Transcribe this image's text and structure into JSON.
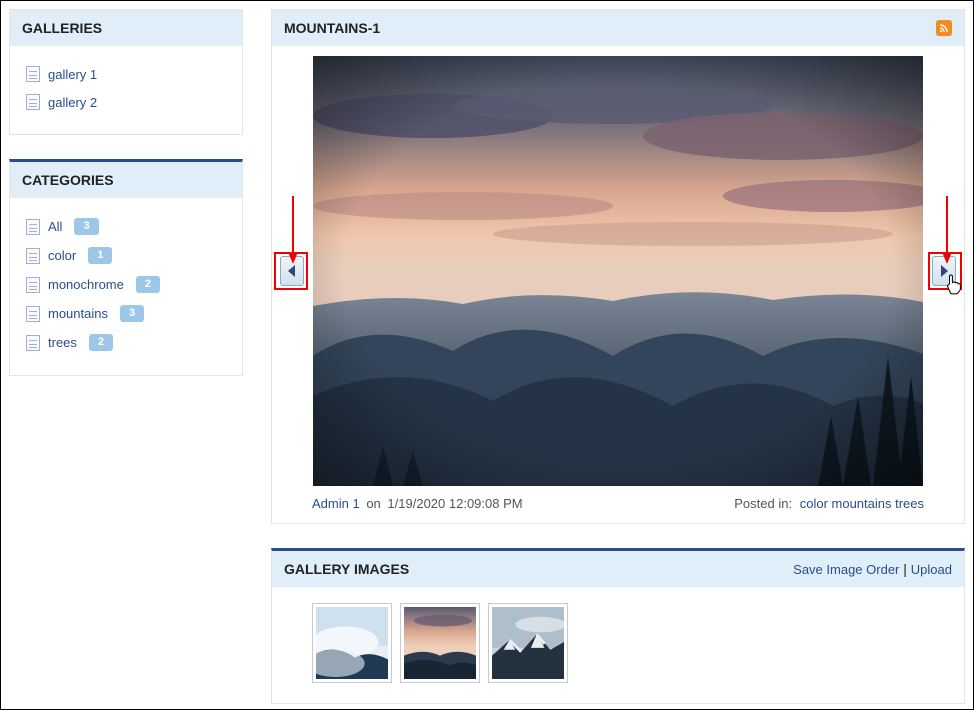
{
  "sidebar": {
    "galleries_title": "GALLERIES",
    "galleries": [
      {
        "label": "gallery 1"
      },
      {
        "label": "gallery 2"
      }
    ],
    "categories_title": "CATEGORIES",
    "categories": [
      {
        "label": "All",
        "count": "3"
      },
      {
        "label": "color",
        "count": "1"
      },
      {
        "label": "monochrome",
        "count": "2"
      },
      {
        "label": "mountains",
        "count": "3"
      },
      {
        "label": "trees",
        "count": "2"
      }
    ]
  },
  "main": {
    "title": "MOUNTAINS-1",
    "author": "Admin 1",
    "meta_on": "on",
    "timestamp": "1/19/2020 12:09:08 PM",
    "posted_in_label": "Posted in:",
    "posted_in": "color mountains trees"
  },
  "gallery_images": {
    "title": "GALLERY IMAGES",
    "save_label": "Save Image Order",
    "upload_label": "Upload",
    "divider": " | "
  }
}
